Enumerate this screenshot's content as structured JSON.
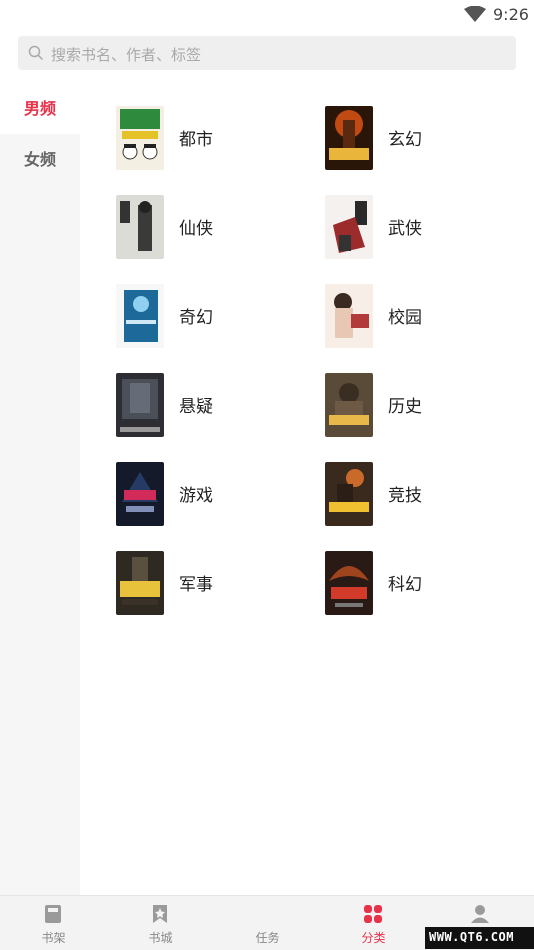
{
  "status_bar": {
    "time": "9:26",
    "wifi_icon": "wifi-icon"
  },
  "search": {
    "placeholder": "搜索书名、作者、标签",
    "icon": "search-icon"
  },
  "sidebar": {
    "items": [
      {
        "label": "男频"
      },
      {
        "label": "女频"
      }
    ],
    "active": 0
  },
  "categories": [
    {
      "label": "都市"
    },
    {
      "label": "玄幻"
    },
    {
      "label": "仙侠"
    },
    {
      "label": "武侠"
    },
    {
      "label": "奇幻"
    },
    {
      "label": "校园"
    },
    {
      "label": "悬疑"
    },
    {
      "label": "历史"
    },
    {
      "label": "游戏"
    },
    {
      "label": "竞技"
    },
    {
      "label": "军事"
    },
    {
      "label": "科幻"
    }
  ],
  "tabbar": {
    "items": [
      {
        "label": "书架",
        "icon": "bookshelf-icon"
      },
      {
        "label": "书城",
        "icon": "bookmark-icon"
      },
      {
        "label": "任务",
        "icon": "task-icon"
      },
      {
        "label": "分类",
        "icon": "grid-icon"
      },
      {
        "label": "",
        "icon": "user-icon"
      }
    ],
    "active": 3
  },
  "watermark": "WWW.QT6.COM",
  "colors": {
    "accent": "#e8324a",
    "sidebar_bg": "#f6f6f6",
    "search_bg": "#efefef"
  }
}
